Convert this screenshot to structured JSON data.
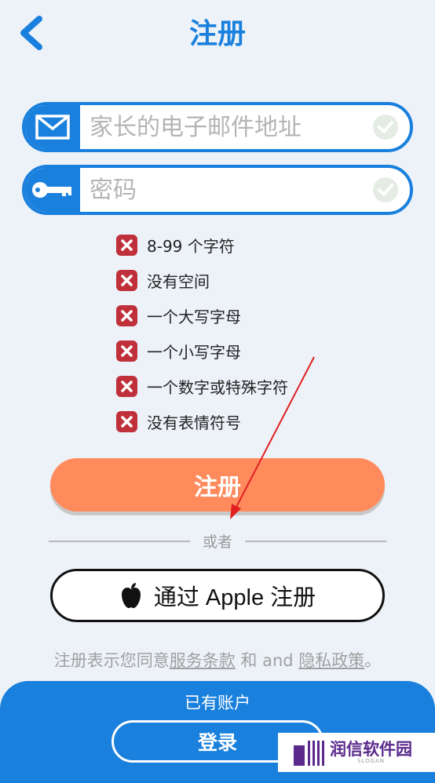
{
  "header": {
    "title": "注册"
  },
  "form": {
    "email_placeholder": "家长的电子邮件地址",
    "password_placeholder": "密码"
  },
  "password_rules": [
    {
      "text": "8-99 个字符",
      "status": "unmet"
    },
    {
      "text": "没有空间",
      "status": "unmet"
    },
    {
      "text": "一个大写字母",
      "status": "unmet"
    },
    {
      "text": "一个小写字母",
      "status": "unmet"
    },
    {
      "text": "一个数字或特殊字符",
      "status": "unmet"
    },
    {
      "text": "没有表情符号",
      "status": "unmet"
    }
  ],
  "actions": {
    "register_label": "注册",
    "divider_label": "或者",
    "apple_label": "通过 Apple 注册"
  },
  "terms": {
    "prefix": "注册表示您同意",
    "tos_link": "服务条款",
    "middle": " 和 and ",
    "privacy_link": "隐私政策",
    "suffix": "。"
  },
  "footer": {
    "has_account": "已有账户",
    "login_label": "登录"
  },
  "watermark": {
    "text": "润信软件园",
    "sub": "SLOGAN"
  },
  "colors": {
    "primary": "#1a80dd",
    "register": "#ff8a5c",
    "error": "#c0303b",
    "background": "#edf2f9"
  }
}
